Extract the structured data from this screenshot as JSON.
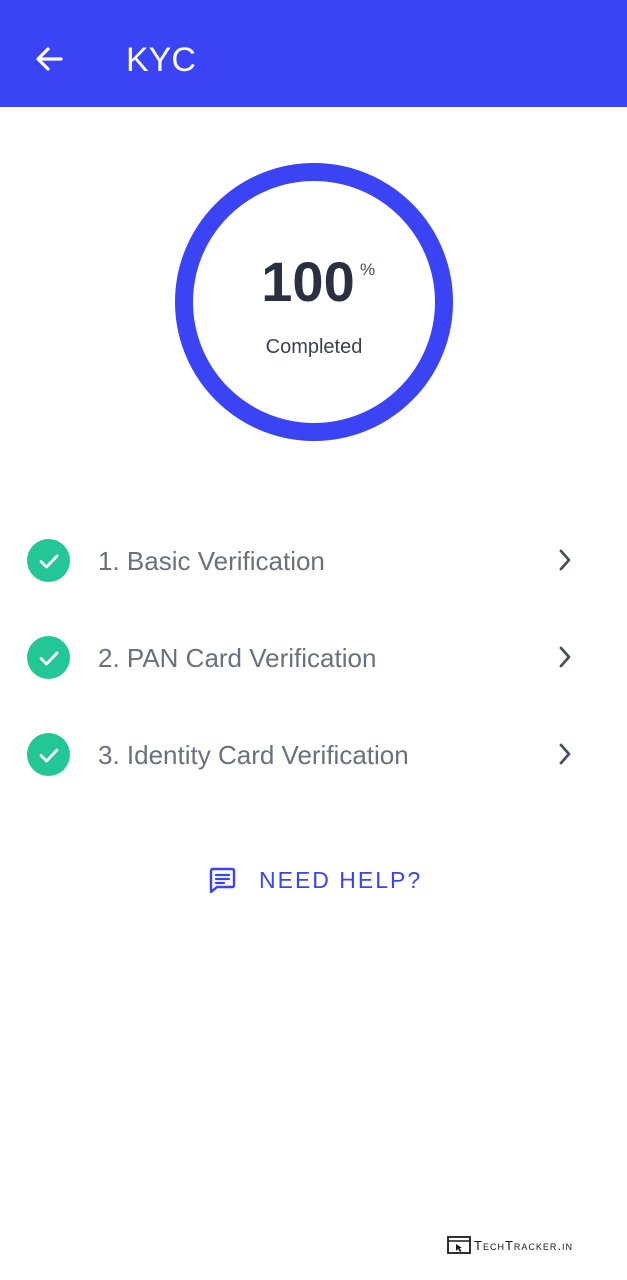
{
  "app_bar": {
    "title": "KYC",
    "background_color": "#3a44f5",
    "back_icon": "arrow-left-icon"
  },
  "progress": {
    "value": "100",
    "unit": "%",
    "caption": "Completed",
    "percent_complete": 100,
    "ring_color": "#3a44f5"
  },
  "steps": [
    {
      "label": "1. Basic Verification",
      "status": "completed",
      "status_icon": "check-circle-icon",
      "action_icon": "chevron-right-icon"
    },
    {
      "label": "2. PAN Card Verification",
      "status": "completed",
      "status_icon": "check-circle-icon",
      "action_icon": "chevron-right-icon"
    },
    {
      "label": "3. Identity Card Verification",
      "status": "completed",
      "status_icon": "check-circle-icon",
      "action_icon": "chevron-right-icon"
    }
  ],
  "help": {
    "label": "NEED HELP?",
    "icon": "chat-message-icon",
    "color": "#3a44f5"
  },
  "status_color": "#23c795",
  "watermark": {
    "text": "TechTracker.in",
    "icon": "browser-cursor-icon"
  }
}
